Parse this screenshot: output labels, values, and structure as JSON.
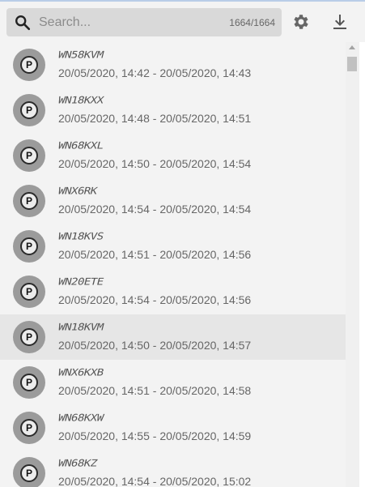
{
  "search": {
    "placeholder": "Search...",
    "count": "1664/1664"
  },
  "toolbar": {
    "settings_icon": "gear-icon",
    "download_icon": "download-icon"
  },
  "items": [
    {
      "plate": "WN58KVM",
      "time": "20/05/2020, 14:42 - 20/05/2020, 14:43",
      "icon": "parking-icon"
    },
    {
      "plate": "WN18KXX",
      "time": "20/05/2020, 14:48 - 20/05/2020, 14:51",
      "icon": "parking-icon"
    },
    {
      "plate": "WN68KXL",
      "time": "20/05/2020, 14:50 - 20/05/2020, 14:54",
      "icon": "parking-icon"
    },
    {
      "plate": "WNX6RK",
      "time": "20/05/2020, 14:54 - 20/05/2020, 14:54",
      "icon": "parking-icon"
    },
    {
      "plate": "WN18KVS",
      "time": "20/05/2020, 14:51 - 20/05/2020, 14:56",
      "icon": "parking-icon"
    },
    {
      "plate": "WN20ETE",
      "time": "20/05/2020, 14:54 - 20/05/2020, 14:56",
      "icon": "parking-icon"
    },
    {
      "plate": "WN18KVM",
      "time": "20/05/2020, 14:50 - 20/05/2020, 14:57",
      "icon": "parking-icon",
      "selected": true
    },
    {
      "plate": "WNX6KXB",
      "time": "20/05/2020, 14:51 - 20/05/2020, 14:58",
      "icon": "parking-icon"
    },
    {
      "plate": "WN68KXW",
      "time": "20/05/2020, 14:55 - 20/05/2020, 14:59",
      "icon": "parking-icon"
    },
    {
      "plate": "WN68KZ",
      "time": "20/05/2020, 14:54 - 20/05/2020, 15:02",
      "icon": "parking-icon"
    }
  ],
  "colors": {
    "background": "#f3f3f3",
    "search_bg": "#d9d9d9",
    "avatar_bg": "#9b9b9b",
    "selected_row": "#e6e6e6",
    "accent_line": "#b9cde8"
  }
}
